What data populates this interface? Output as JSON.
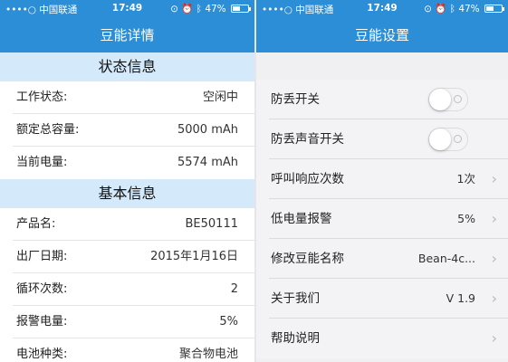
{
  "status_bar": {
    "carrier": "••••○ 中国联通",
    "time": "17:49",
    "battery_percent": "47%",
    "battery_level": 0.47
  },
  "left": {
    "title": "豆能详情",
    "section_status": "状态信息",
    "status_rows": [
      {
        "label": "工作状态:",
        "value": "空闲中"
      },
      {
        "label": "额定总容量:",
        "value": "5000 mAh"
      },
      {
        "label": "当前电量:",
        "value": "5574 mAh"
      }
    ],
    "section_basic": "基本信息",
    "basic_rows": [
      {
        "label": "产品名:",
        "value": "BE50111"
      },
      {
        "label": "出厂日期:",
        "value": "2015年1月16日"
      },
      {
        "label": "循环次数:",
        "value": "2"
      },
      {
        "label": "报警电量:",
        "value": "5%"
      },
      {
        "label": "电池种类:",
        "value": "聚合物电池"
      }
    ]
  },
  "right": {
    "title": "豆能设置",
    "rows": [
      {
        "label": "防丢开关",
        "type": "toggle",
        "on": false
      },
      {
        "label": "防丢声音开关",
        "type": "toggle",
        "on": false
      },
      {
        "label": "呼叫响应次数",
        "value": "1次"
      },
      {
        "label": "低电量报警",
        "value": "5%"
      },
      {
        "label": "修改豆能名称",
        "value": "Bean-4c..."
      },
      {
        "label": "关于我们",
        "value": "V 1.9"
      },
      {
        "label": "帮助说明",
        "value": ""
      }
    ]
  },
  "colors": {
    "header_blue": "#2b8ed6",
    "section_blue": "#d4e9f9"
  },
  "icons": [
    "signal-dots-icon",
    "wifi-icon",
    "location-icon",
    "alarm-icon",
    "bluetooth-icon",
    "battery-icon",
    "chevron-right-icon"
  ]
}
